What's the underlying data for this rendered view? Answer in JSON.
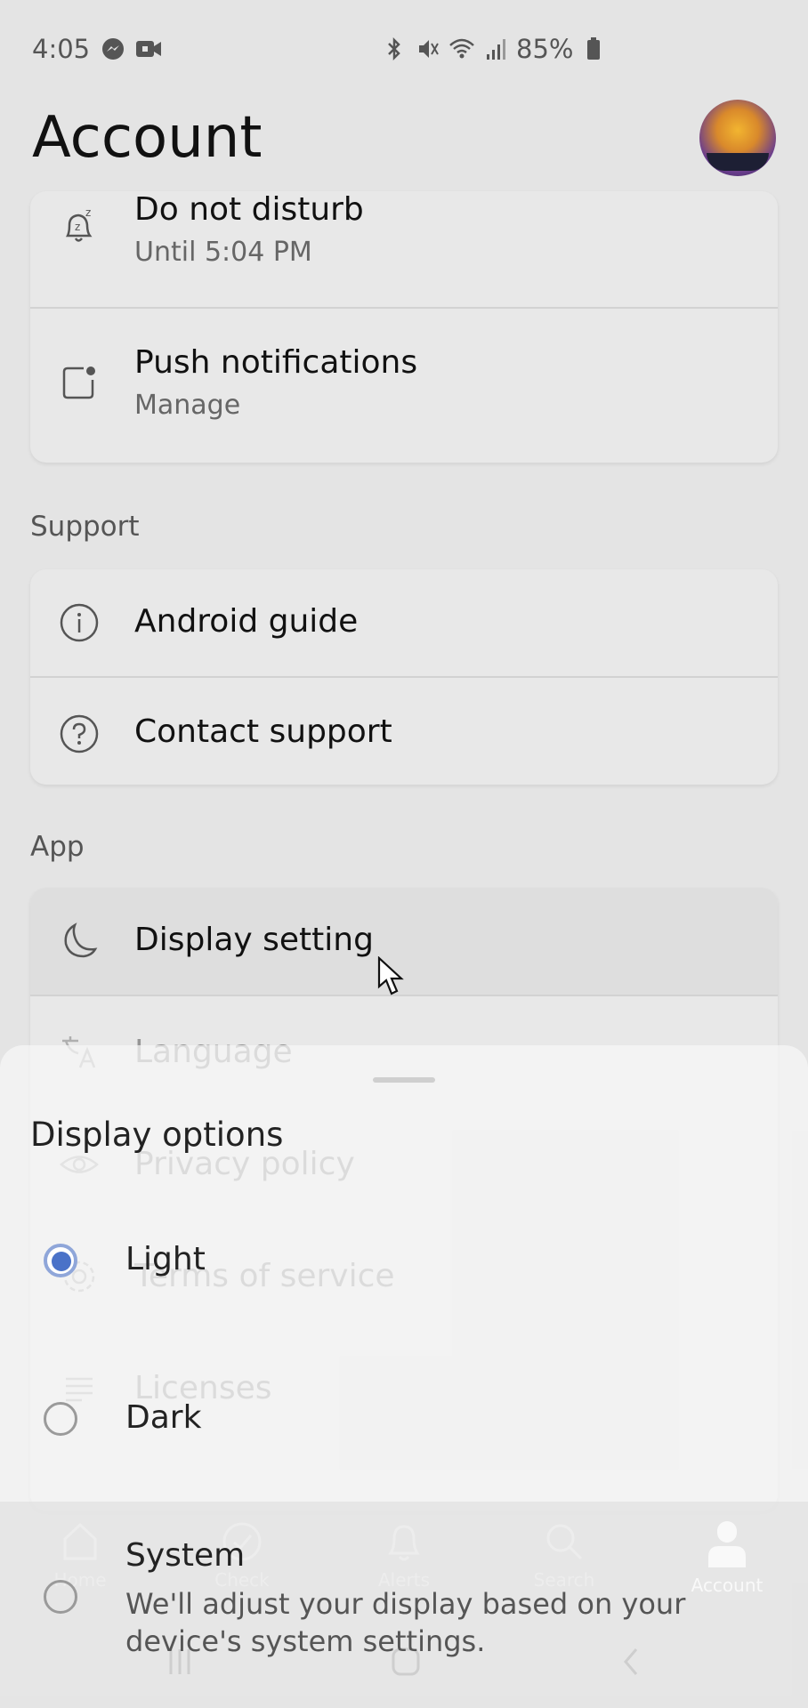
{
  "status_bar": {
    "time": "4:05",
    "notification_icons": [
      "messenger-icon",
      "video-camera-icon"
    ],
    "system_icons": [
      "bluetooth-icon",
      "vibrate-mute-icon",
      "wifi-icon",
      "signal-icon"
    ],
    "battery": "85%"
  },
  "header": {
    "title": "Account",
    "avatar": "profile-photo"
  },
  "notifications_card": {
    "items": [
      {
        "icon": "do-not-disturb-bell-icon",
        "label": "Do not disturb",
        "sublabel": "Until 5:04 PM"
      },
      {
        "icon": "push-notification-icon",
        "label": "Push notifications",
        "sublabel": "Manage"
      }
    ]
  },
  "support": {
    "heading": "Support",
    "items": [
      {
        "icon": "info-icon",
        "label": "Android guide"
      },
      {
        "icon": "help-icon",
        "label": "Contact support"
      }
    ]
  },
  "app": {
    "heading": "App",
    "items": [
      {
        "icon": "moon-icon",
        "label": "Display setting"
      },
      {
        "icon": "translate-icon",
        "label": "Language"
      },
      {
        "icon": "eye-icon",
        "label": "Privacy policy"
      },
      {
        "icon": "gear-icon",
        "label": "Terms of service"
      },
      {
        "icon": "list-icon",
        "label": "Licenses"
      }
    ]
  },
  "bottom_nav": {
    "items": [
      {
        "icon": "home-icon",
        "label": "Home"
      },
      {
        "icon": "check-circle-icon",
        "label": "Check"
      },
      {
        "icon": "bell-icon",
        "label": "Alerts"
      },
      {
        "icon": "search-icon",
        "label": "Search"
      },
      {
        "icon": "person-icon",
        "label": "Account",
        "active": true
      }
    ]
  },
  "display_sheet": {
    "title": "Display options",
    "options": [
      {
        "label": "Light",
        "selected": true
      },
      {
        "label": "Dark",
        "selected": false
      },
      {
        "label": "System",
        "selected": false,
        "description": "We'll adjust your display based on your device's system settings."
      }
    ]
  },
  "system_nav": [
    "recents-icon",
    "home-button-icon",
    "back-icon"
  ],
  "colors": {
    "accent": "#4a72c8",
    "background": "#e4e4e4"
  }
}
